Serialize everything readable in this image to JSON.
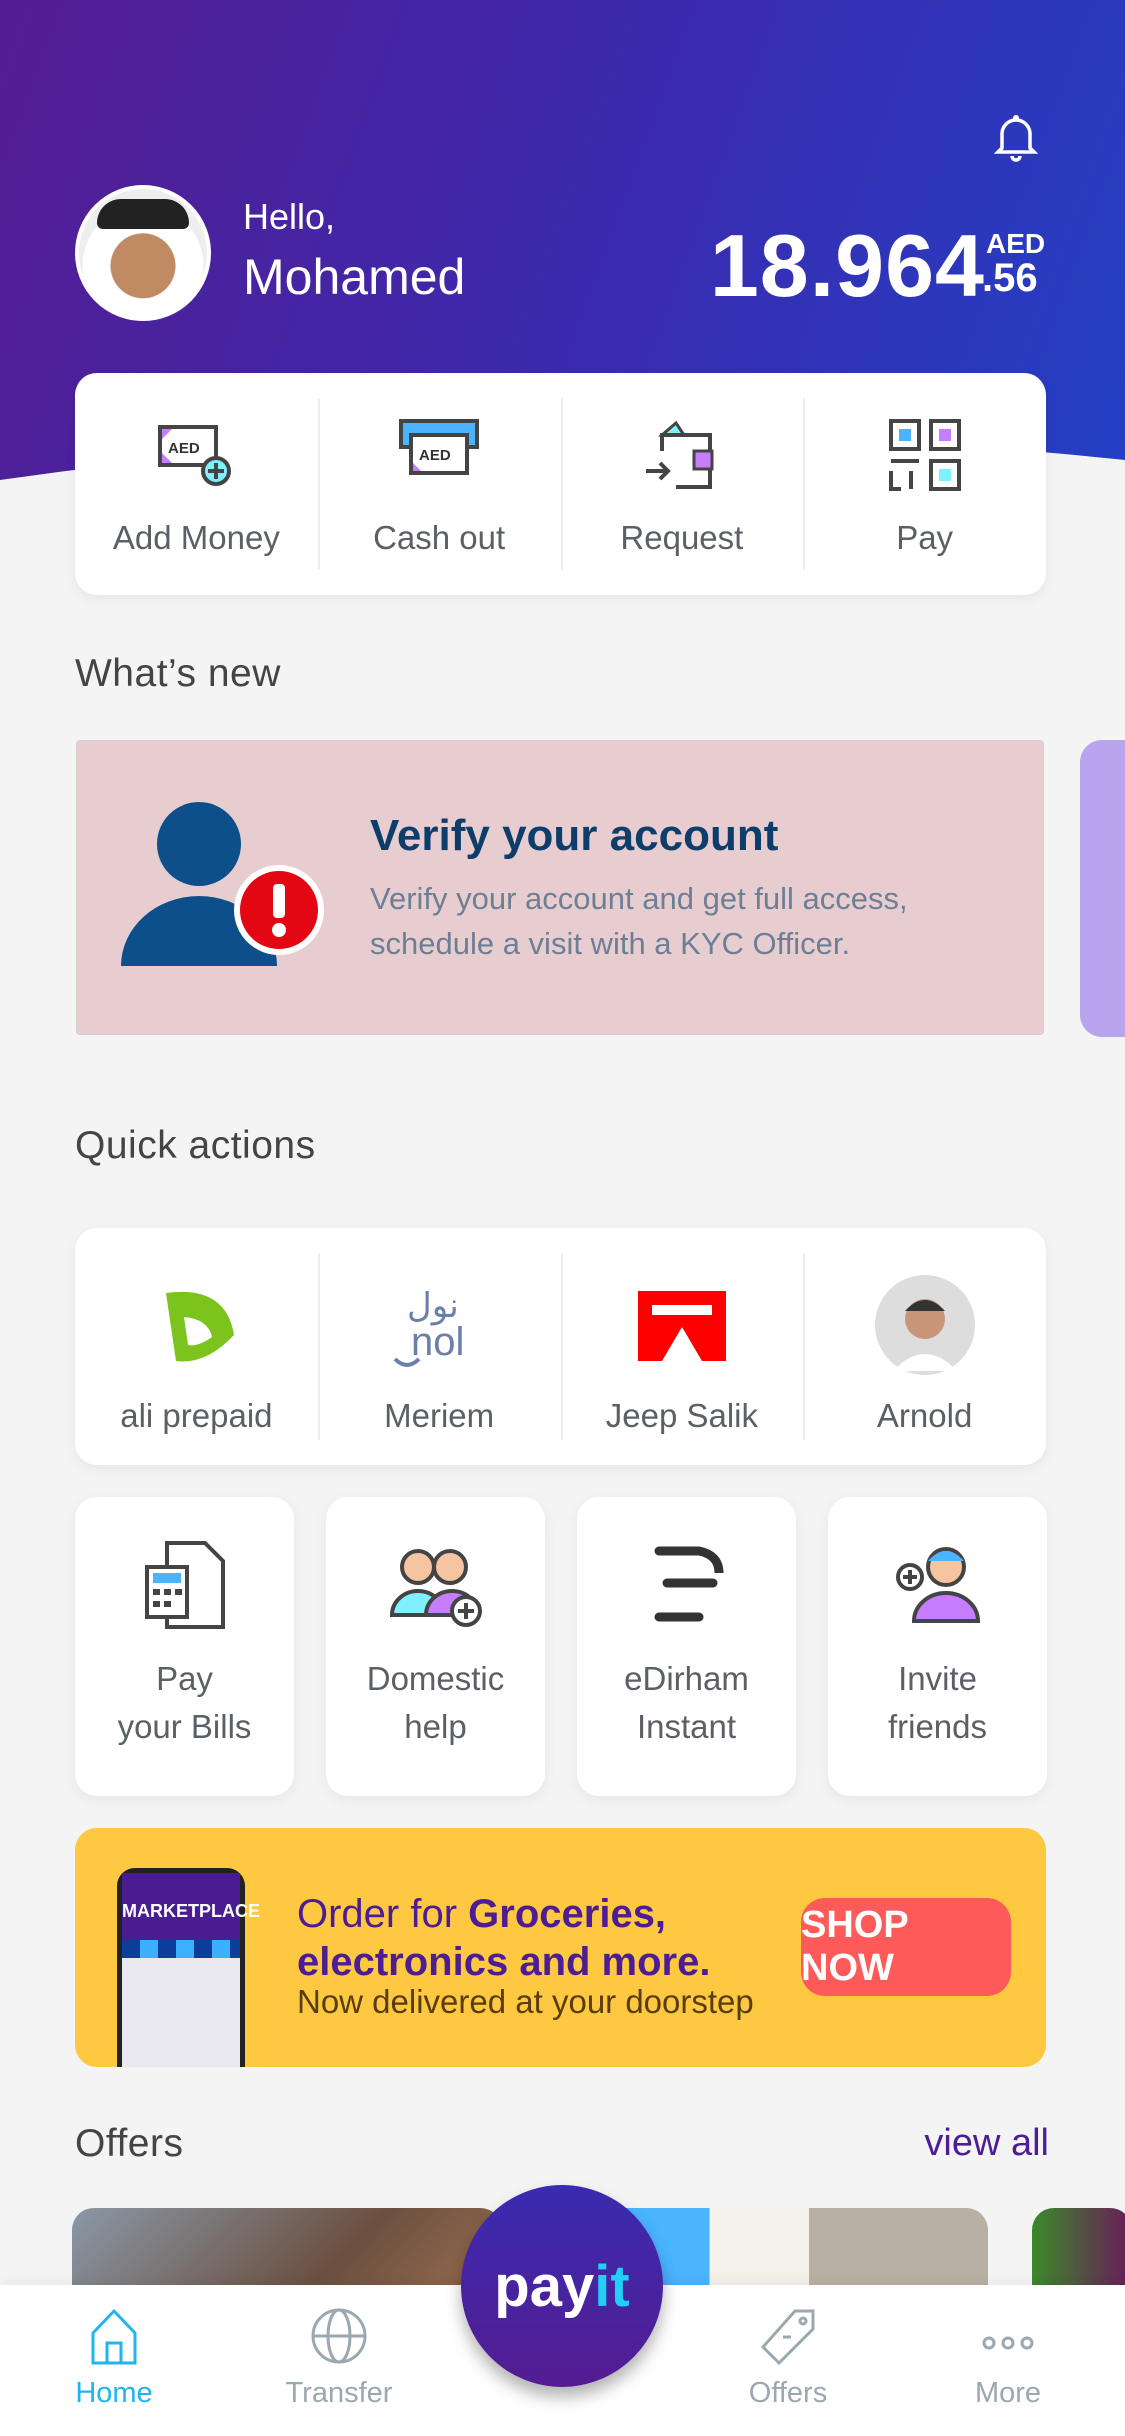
{
  "header": {
    "greeting": "Hello,",
    "name": "Mohamed",
    "balance_whole": "18.964",
    "balance_currency": "AED",
    "balance_decimal": ".56"
  },
  "actions": [
    {
      "label": "Add Money",
      "icon": "add-money-icon"
    },
    {
      "label": "Cash out",
      "icon": "cash-out-icon"
    },
    {
      "label": "Request",
      "icon": "request-wallet-icon"
    },
    {
      "label": "Pay",
      "icon": "qr-code-icon"
    }
  ],
  "whats_new": {
    "title": "What’s new",
    "banner_title": "Verify your account",
    "banner_text": "Verify your account and get full access, schedule a visit with a KYC Officer."
  },
  "quick_actions": {
    "title": "Quick actions",
    "contacts": [
      {
        "label": "ali prepaid",
        "icon": "etisalat-logo"
      },
      {
        "label": "Meriem",
        "icon": "nol-logo"
      },
      {
        "label": "Jeep Salik",
        "icon": "salik-logo"
      },
      {
        "label": "Arnold",
        "icon": "avatar"
      }
    ],
    "tiles": [
      {
        "line1": "Pay",
        "line2": "your Bills"
      },
      {
        "line1": "Domestic",
        "line2": "help"
      },
      {
        "line1": "eDirham",
        "line2": "Instant"
      },
      {
        "line1": "Invite",
        "line2": "friends"
      }
    ]
  },
  "marketplace": {
    "phone_label": "MARKETPLACE",
    "line1_regular": "Order for ",
    "line1_bold": "Groceries,",
    "line2_bold": "electronics and more.",
    "subtitle": "Now delivered at your doorstep",
    "button": "SHOP NOW"
  },
  "offers": {
    "title": "Offers",
    "view_all": "view all"
  },
  "nav": {
    "items": [
      {
        "label": "Home",
        "active": true
      },
      {
        "label": "Transfer"
      },
      {
        "label": "Offers"
      },
      {
        "label": "More"
      }
    ],
    "center_pay": "pay",
    "center_it": "it"
  },
  "colors": {
    "brand_purple": "#4c1d95",
    "accent_cyan": "#20b5ef",
    "market_yellow": "#fec840",
    "shop_red": "#fe5a5a"
  }
}
